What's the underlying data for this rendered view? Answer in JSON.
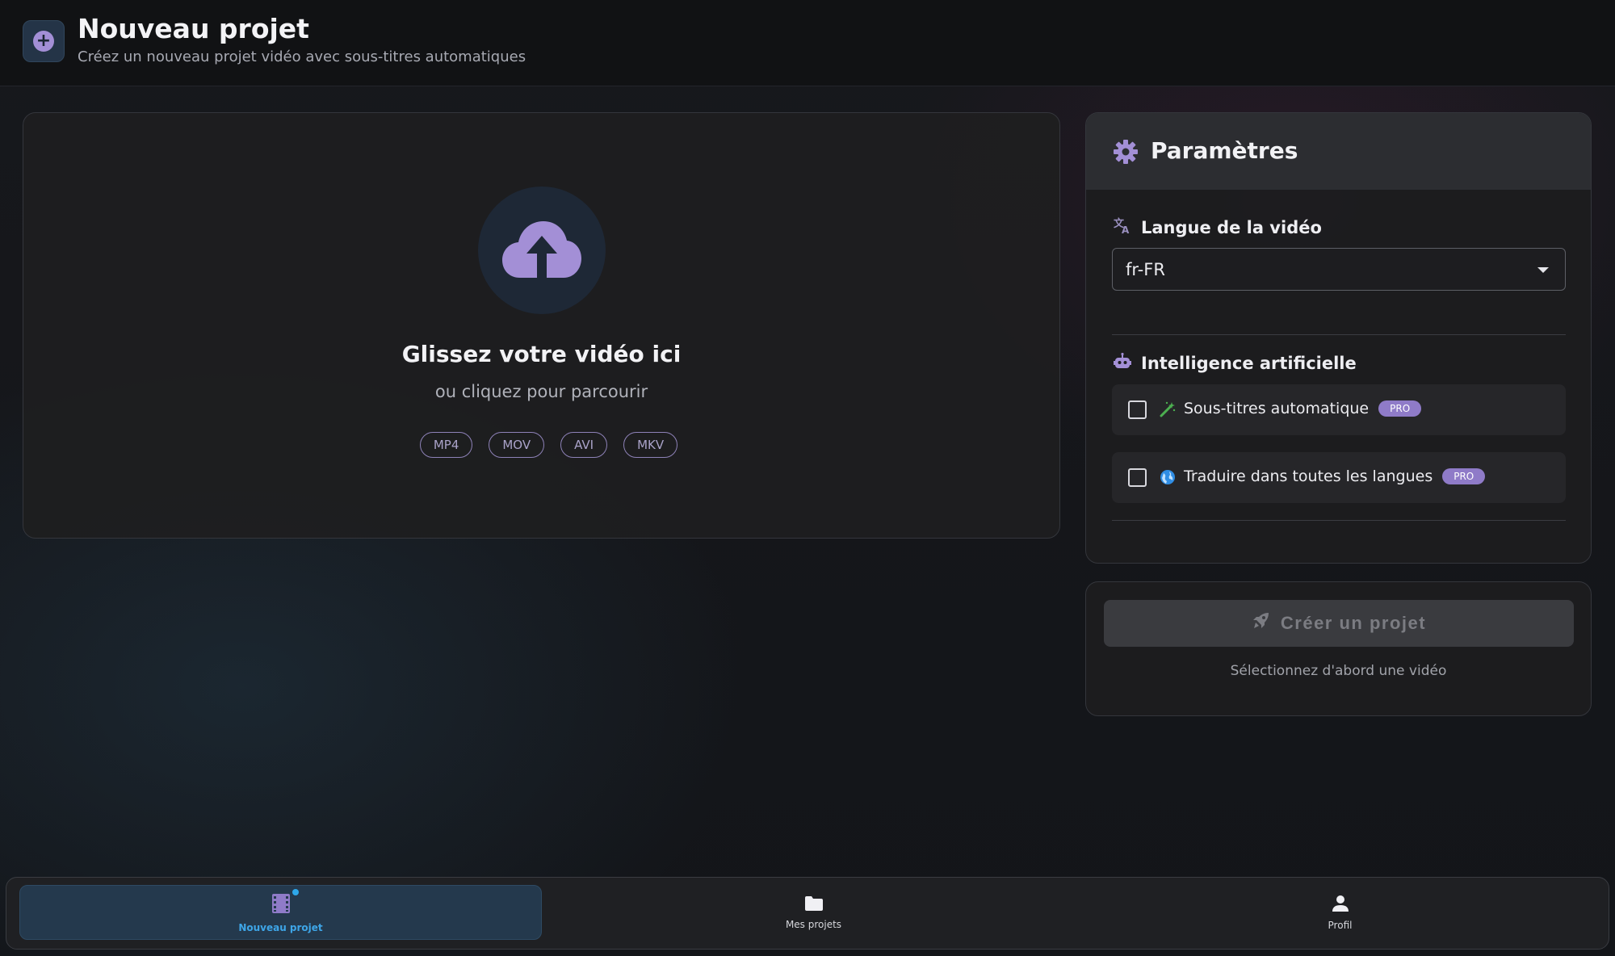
{
  "header": {
    "title": "Nouveau projet",
    "subtitle": "Créez un nouveau projet vidéo avec sous-titres automatiques",
    "icon": "plus-circle-icon"
  },
  "upload": {
    "icon": "cloud-upload-icon",
    "title": "Glissez votre vidéo ici",
    "subtitle": "ou cliquez pour parcourir",
    "formats": [
      "MP4",
      "MOV",
      "AVI",
      "MKV"
    ]
  },
  "settings": {
    "title": "Paramètres",
    "language": {
      "label": "Langue de la vidéo",
      "value": "fr-FR"
    },
    "ai": {
      "label": "Intelligence artificielle",
      "options": [
        {
          "label": "Sous-titres automatique",
          "badge": "PRO",
          "icon": "magic-wand-icon",
          "checked": false
        },
        {
          "label": "Traduire dans toutes les langues",
          "badge": "PRO",
          "icon": "globe-icon",
          "checked": false
        }
      ]
    }
  },
  "create": {
    "button_label": "Créer un projet",
    "hint": "Sélectionnez d'abord une vidéo"
  },
  "nav": {
    "items": [
      {
        "label": "Nouveau projet",
        "icon": "film-icon",
        "active": true
      },
      {
        "label": "Mes projets",
        "icon": "folder-icon",
        "active": false
      },
      {
        "label": "Profil",
        "icon": "person-icon",
        "active": false
      }
    ]
  },
  "colors": {
    "accent": "#a38fd6",
    "active_nav": "#3ea6e8",
    "pro_badge": "#8f7bc8"
  }
}
